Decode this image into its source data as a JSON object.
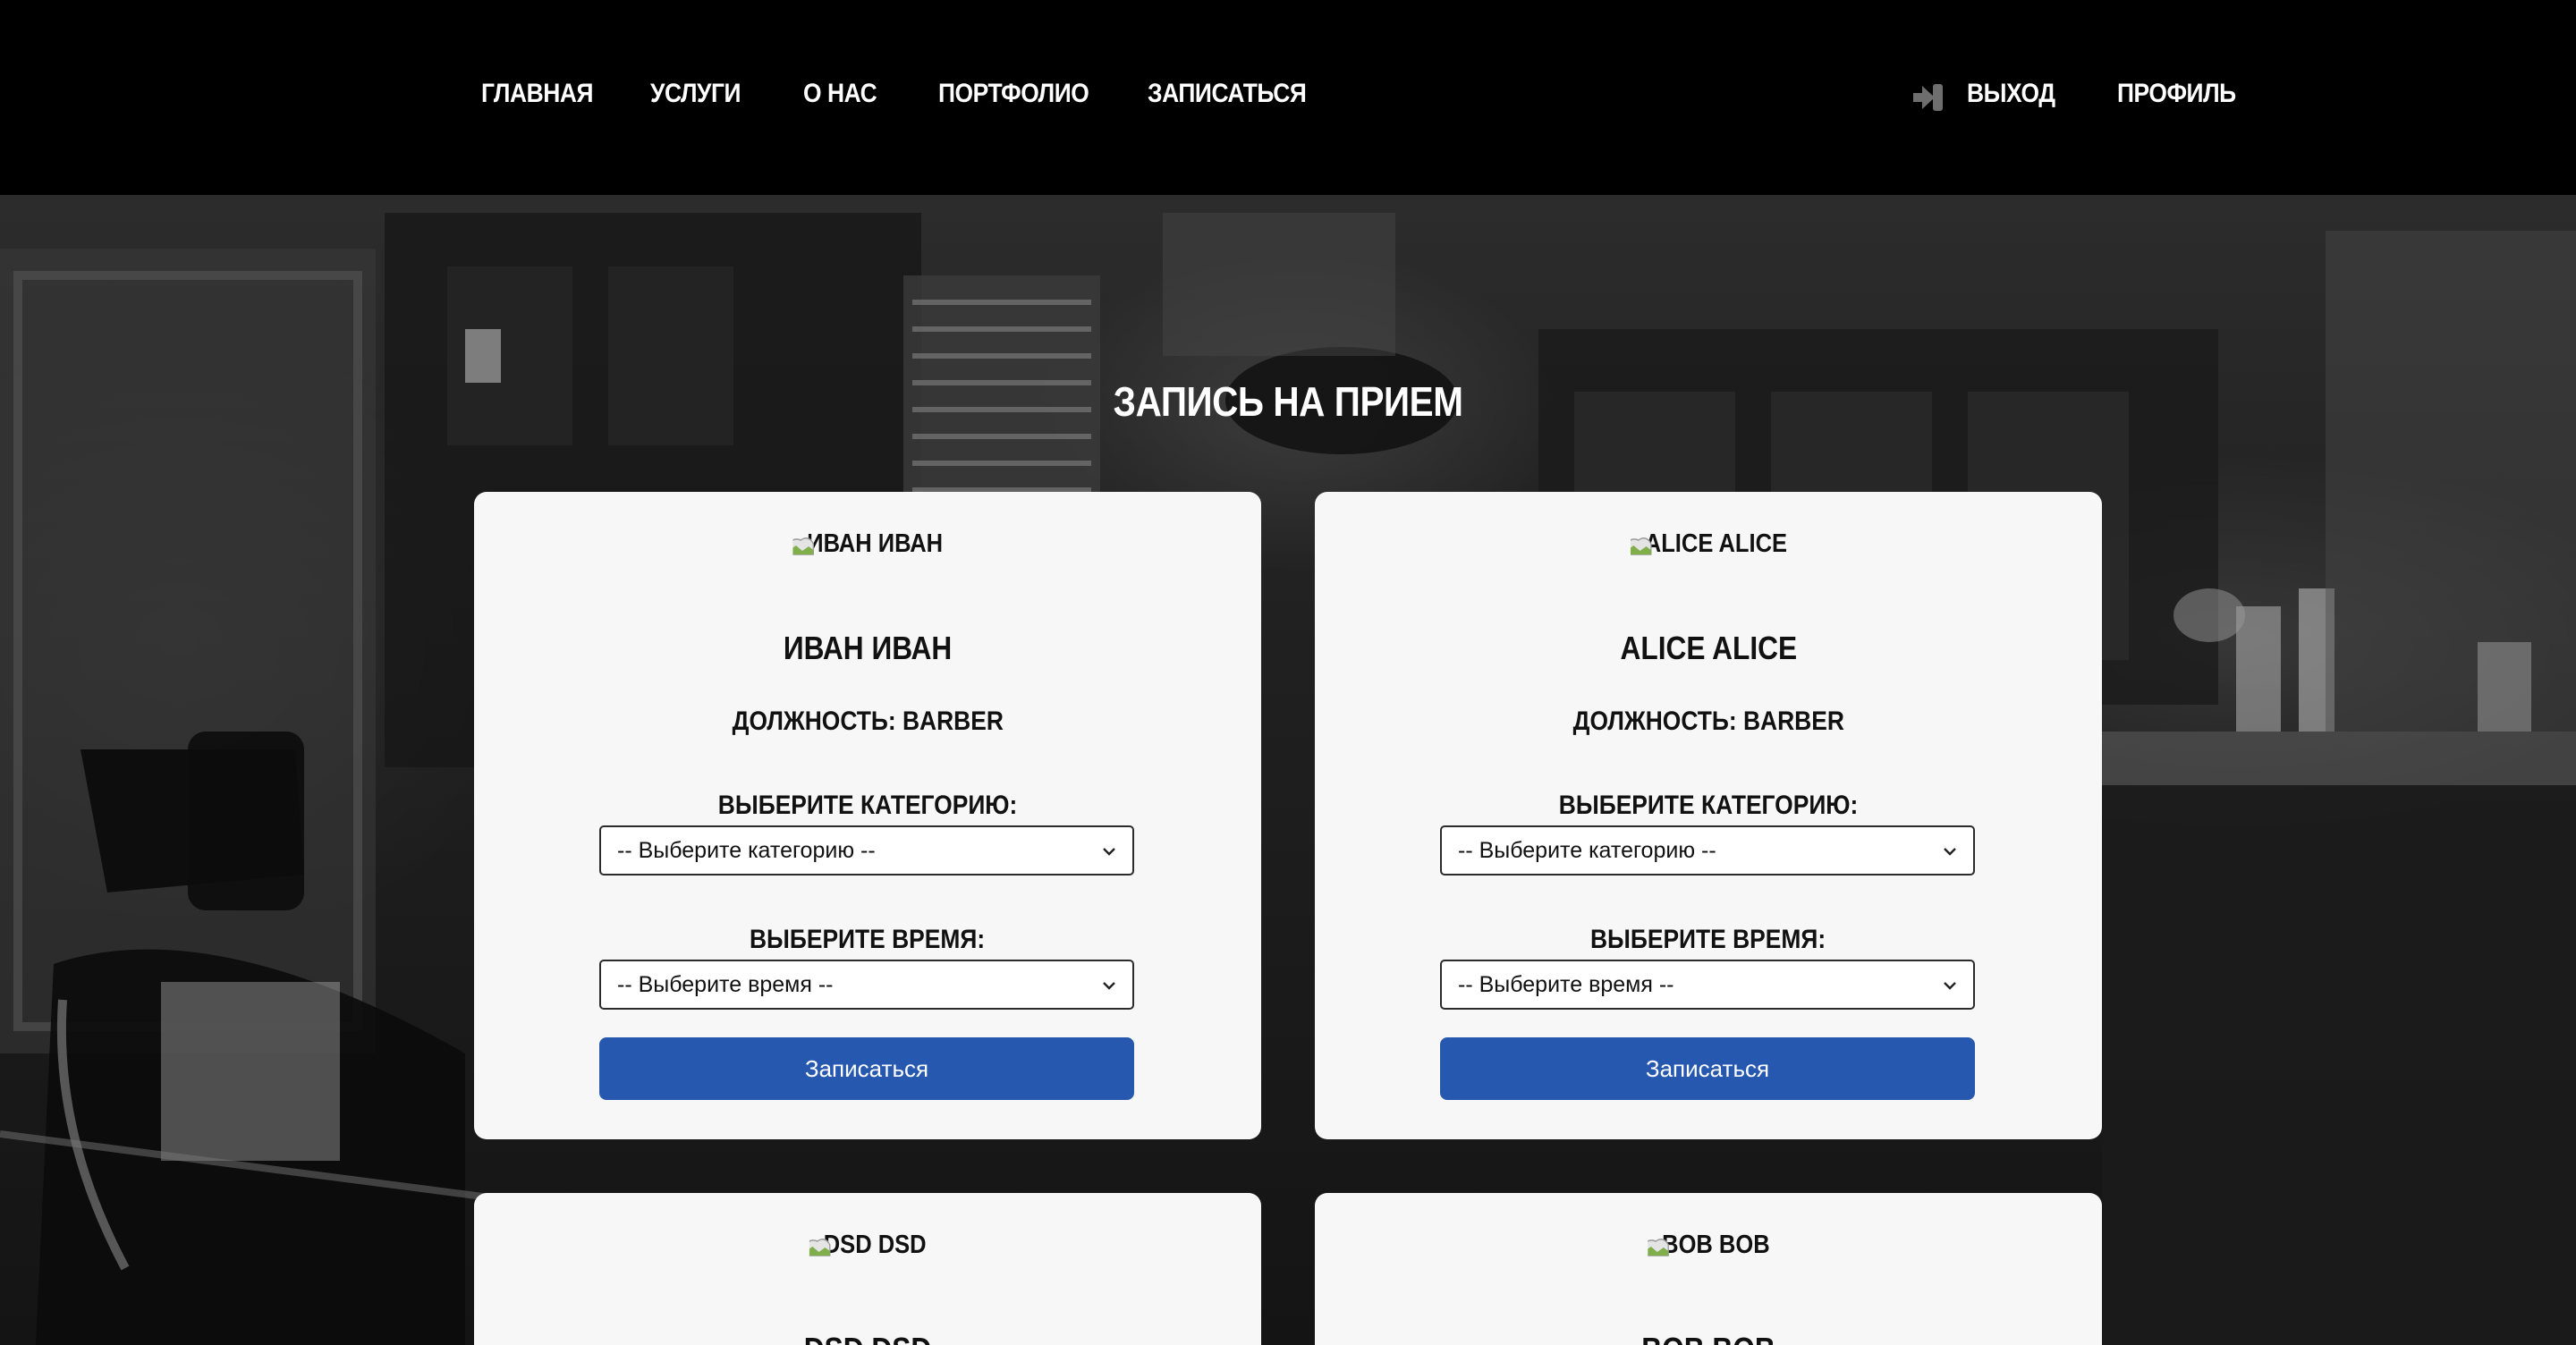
{
  "nav": {
    "links": [
      "ГЛАВНАЯ",
      "УСЛУГИ",
      "О НАС",
      "ПОРТФОЛИО",
      "ЗАПИСАТЬСЯ"
    ],
    "logout_label": "ВЫХОД",
    "profile_label": "ПРОФИЛЬ"
  },
  "page": {
    "title": "ЗАПИСЬ НА ПРИЕМ"
  },
  "form": {
    "category_label": "ВЫБЕРИТЕ КАТЕГОРИЮ:",
    "category_placeholder": "-- Выберите категорию --",
    "time_label": "ВЫБЕРИТЕ ВРЕМЯ:",
    "time_placeholder": "-- Выберите время --",
    "submit_label": "Записаться"
  },
  "barbers": [
    {
      "img_alt": "ИВАН ИВАН",
      "name": "ИВАН ИВАН",
      "position": "ДОЛЖНОСТЬ: BARBER"
    },
    {
      "img_alt": "ALICE ALICE",
      "name": "ALICE ALICE",
      "position": "ДОЛЖНОСТЬ: BARBER"
    },
    {
      "img_alt": "DSD DSD",
      "name": "DSD DSD",
      "position": ""
    },
    {
      "img_alt": "BOB BOB",
      "name": "BOB BOB",
      "position": ""
    }
  ]
}
